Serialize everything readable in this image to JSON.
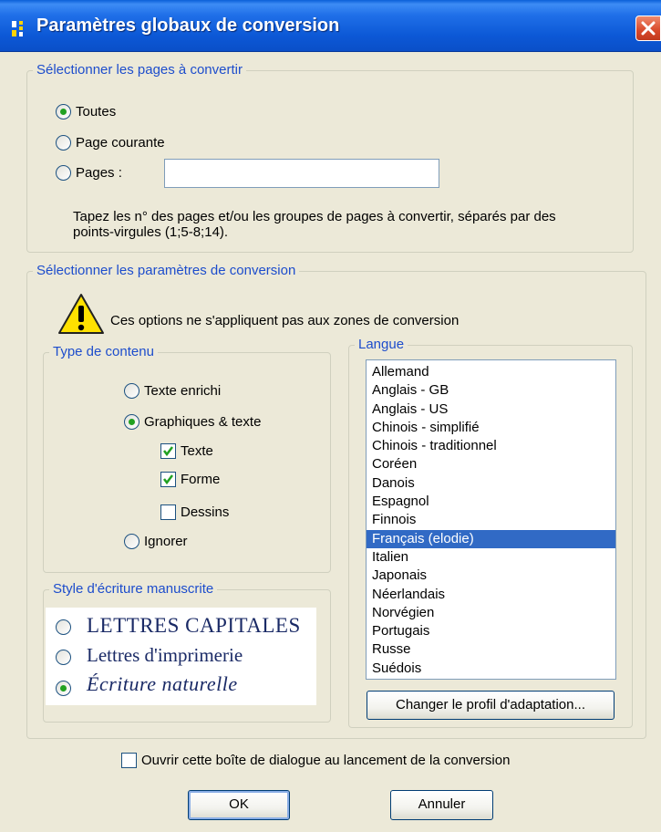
{
  "window": {
    "title": "Paramètres globaux de conversion",
    "title_icon": "settings-app-icon",
    "close_icon": "close-icon"
  },
  "pages_group": {
    "legend": "Sélectionner les pages à convertir",
    "options": [
      {
        "label": "Toutes",
        "selected": true
      },
      {
        "label": "Page courante",
        "selected": false
      },
      {
        "label": "Pages :",
        "selected": false
      }
    ],
    "pages_input_value": "",
    "hint_line1": "Tapez les n° des pages et/ou les groupes de pages à convertir, séparés par des",
    "hint_line2": "points-virgules (1;5-8;14)."
  },
  "params_group": {
    "legend": "Sélectionner les paramètres de conversion",
    "warning_icon": "warning-icon",
    "warning_text": "Ces options ne s'appliquent pas aux zones de conversion"
  },
  "content_type": {
    "legend": "Type de contenu",
    "options": [
      {
        "label": "Texte enrichi",
        "selected": false
      },
      {
        "label": "Graphiques & texte",
        "selected": true
      },
      {
        "label": "Ignorer",
        "selected": false
      }
    ],
    "checkboxes": [
      {
        "label": "Texte",
        "checked": true
      },
      {
        "label": "Forme",
        "checked": true
      },
      {
        "label": "Dessins",
        "checked": false
      }
    ]
  },
  "handwriting": {
    "legend": "Style d'écriture manuscrite",
    "options": [
      {
        "label": "LETTRES CAPITALES",
        "selected": false
      },
      {
        "label": "Lettres d'imprimerie",
        "selected": false
      },
      {
        "label": "Écriture naturelle",
        "selected": true
      }
    ]
  },
  "language": {
    "legend": "Langue",
    "items": [
      "Allemand",
      "Anglais - GB",
      "Anglais - US",
      "Chinois - simplifié",
      "Chinois - traditionnel",
      "Coréen",
      "Danois",
      "Espagnol",
      "Finnois",
      "Français (elodie)",
      "Italien",
      "Japonais",
      "Néerlandais",
      "Norvégien",
      "Portugais",
      "Russe",
      "Suédois"
    ],
    "selected_item": "Français (elodie)",
    "profile_button": "Changer le profil d'adaptation..."
  },
  "footer": {
    "open_dialog_checkbox": "Ouvrir cette boîte de dialogue au lancement de la conversion",
    "open_dialog_checked": false,
    "ok_button": "OK",
    "cancel_button": "Annuler"
  },
  "colors": {
    "titlebar": "#0c58d6",
    "dialog_bg": "#ece9d8",
    "legend_text": "#1d4dcc",
    "selection": "#316ac5",
    "radio_dot": "#21a121",
    "checkmark": "#21a121",
    "close_button": "#d8482a"
  }
}
